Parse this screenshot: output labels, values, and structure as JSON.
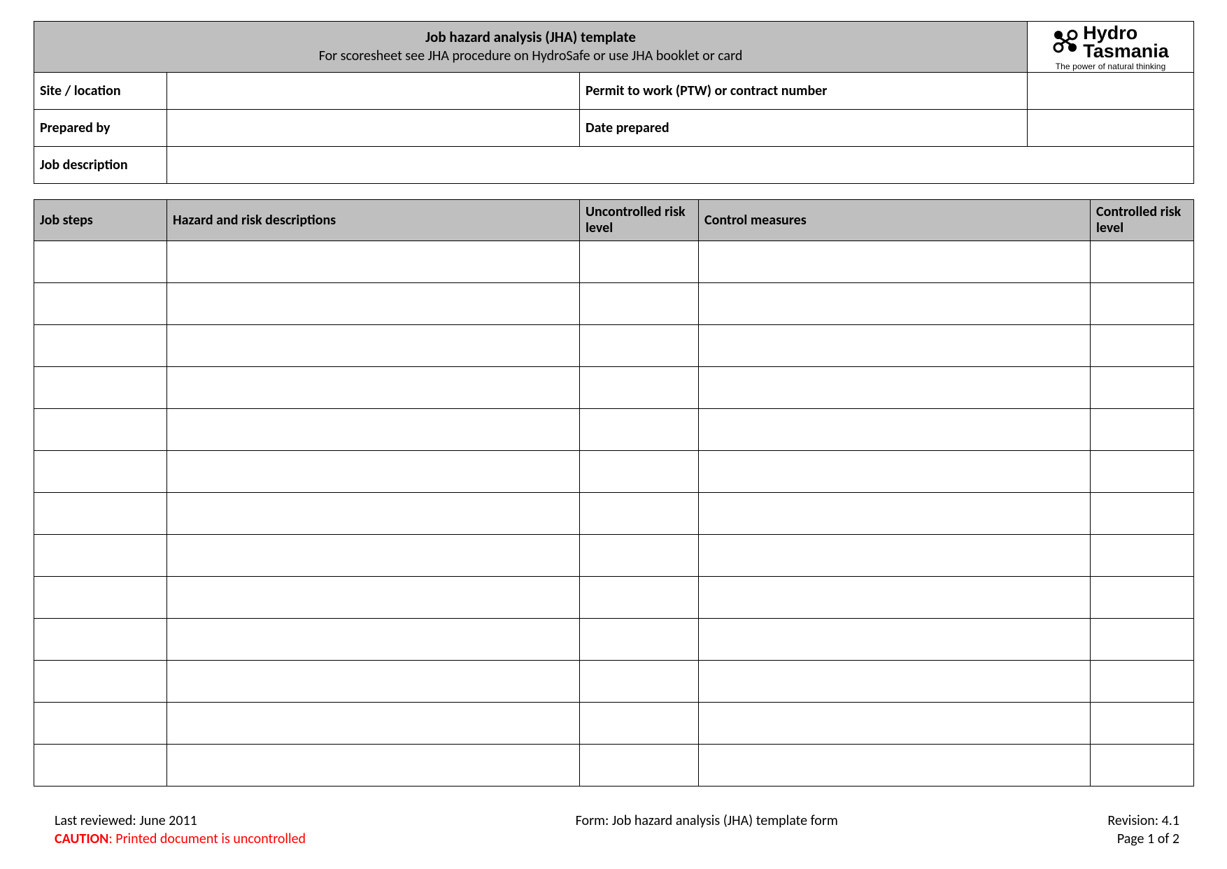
{
  "header": {
    "title": "Job hazard analysis (JHA) template",
    "subtitle": "For scoresheet see JHA procedure on HydroSafe or use JHA booklet or card"
  },
  "logo": {
    "line1": "Hydro",
    "line2": "Tasmania",
    "tagline": "The power of natural thinking"
  },
  "info": {
    "site_location_label": "Site / location",
    "site_location_value": "",
    "permit_label": "Permit to work (PTW) or contract number",
    "permit_value": "",
    "prepared_by_label": "Prepared by",
    "prepared_by_value": "",
    "date_prepared_label": "Date prepared",
    "date_prepared_value": "",
    "job_description_label": "Job description",
    "job_description_value": ""
  },
  "steps_table": {
    "headers": {
      "job_steps": "Job steps",
      "hazard": "Hazard and risk descriptions",
      "uncontrolled": "Uncontrolled risk level",
      "control": "Control measures",
      "controlled": "Controlled risk level"
    },
    "rows": [
      {
        "job_steps": "",
        "hazard": "",
        "uncontrolled": "",
        "control": "",
        "controlled": ""
      },
      {
        "job_steps": "",
        "hazard": "",
        "uncontrolled": "",
        "control": "",
        "controlled": ""
      },
      {
        "job_steps": "",
        "hazard": "",
        "uncontrolled": "",
        "control": "",
        "controlled": ""
      },
      {
        "job_steps": "",
        "hazard": "",
        "uncontrolled": "",
        "control": "",
        "controlled": ""
      },
      {
        "job_steps": "",
        "hazard": "",
        "uncontrolled": "",
        "control": "",
        "controlled": ""
      },
      {
        "job_steps": "",
        "hazard": "",
        "uncontrolled": "",
        "control": "",
        "controlled": ""
      },
      {
        "job_steps": "",
        "hazard": "",
        "uncontrolled": "",
        "control": "",
        "controlled": ""
      },
      {
        "job_steps": "",
        "hazard": "",
        "uncontrolled": "",
        "control": "",
        "controlled": ""
      },
      {
        "job_steps": "",
        "hazard": "",
        "uncontrolled": "",
        "control": "",
        "controlled": ""
      },
      {
        "job_steps": "",
        "hazard": "",
        "uncontrolled": "",
        "control": "",
        "controlled": ""
      },
      {
        "job_steps": "",
        "hazard": "",
        "uncontrolled": "",
        "control": "",
        "controlled": ""
      },
      {
        "job_steps": "",
        "hazard": "",
        "uncontrolled": "",
        "control": "",
        "controlled": ""
      },
      {
        "job_steps": "",
        "hazard": "",
        "uncontrolled": "",
        "control": "",
        "controlled": ""
      }
    ]
  },
  "footer": {
    "last_reviewed_label": "Last reviewed: ",
    "last_reviewed_value": "June 2011",
    "caution_label": "CAUTION",
    "caution_text": ": Printed document is uncontrolled",
    "form_name": "Form: Job hazard analysis (JHA) template form",
    "revision": "Revision: 4.1",
    "page": "Page 1 of 2"
  }
}
